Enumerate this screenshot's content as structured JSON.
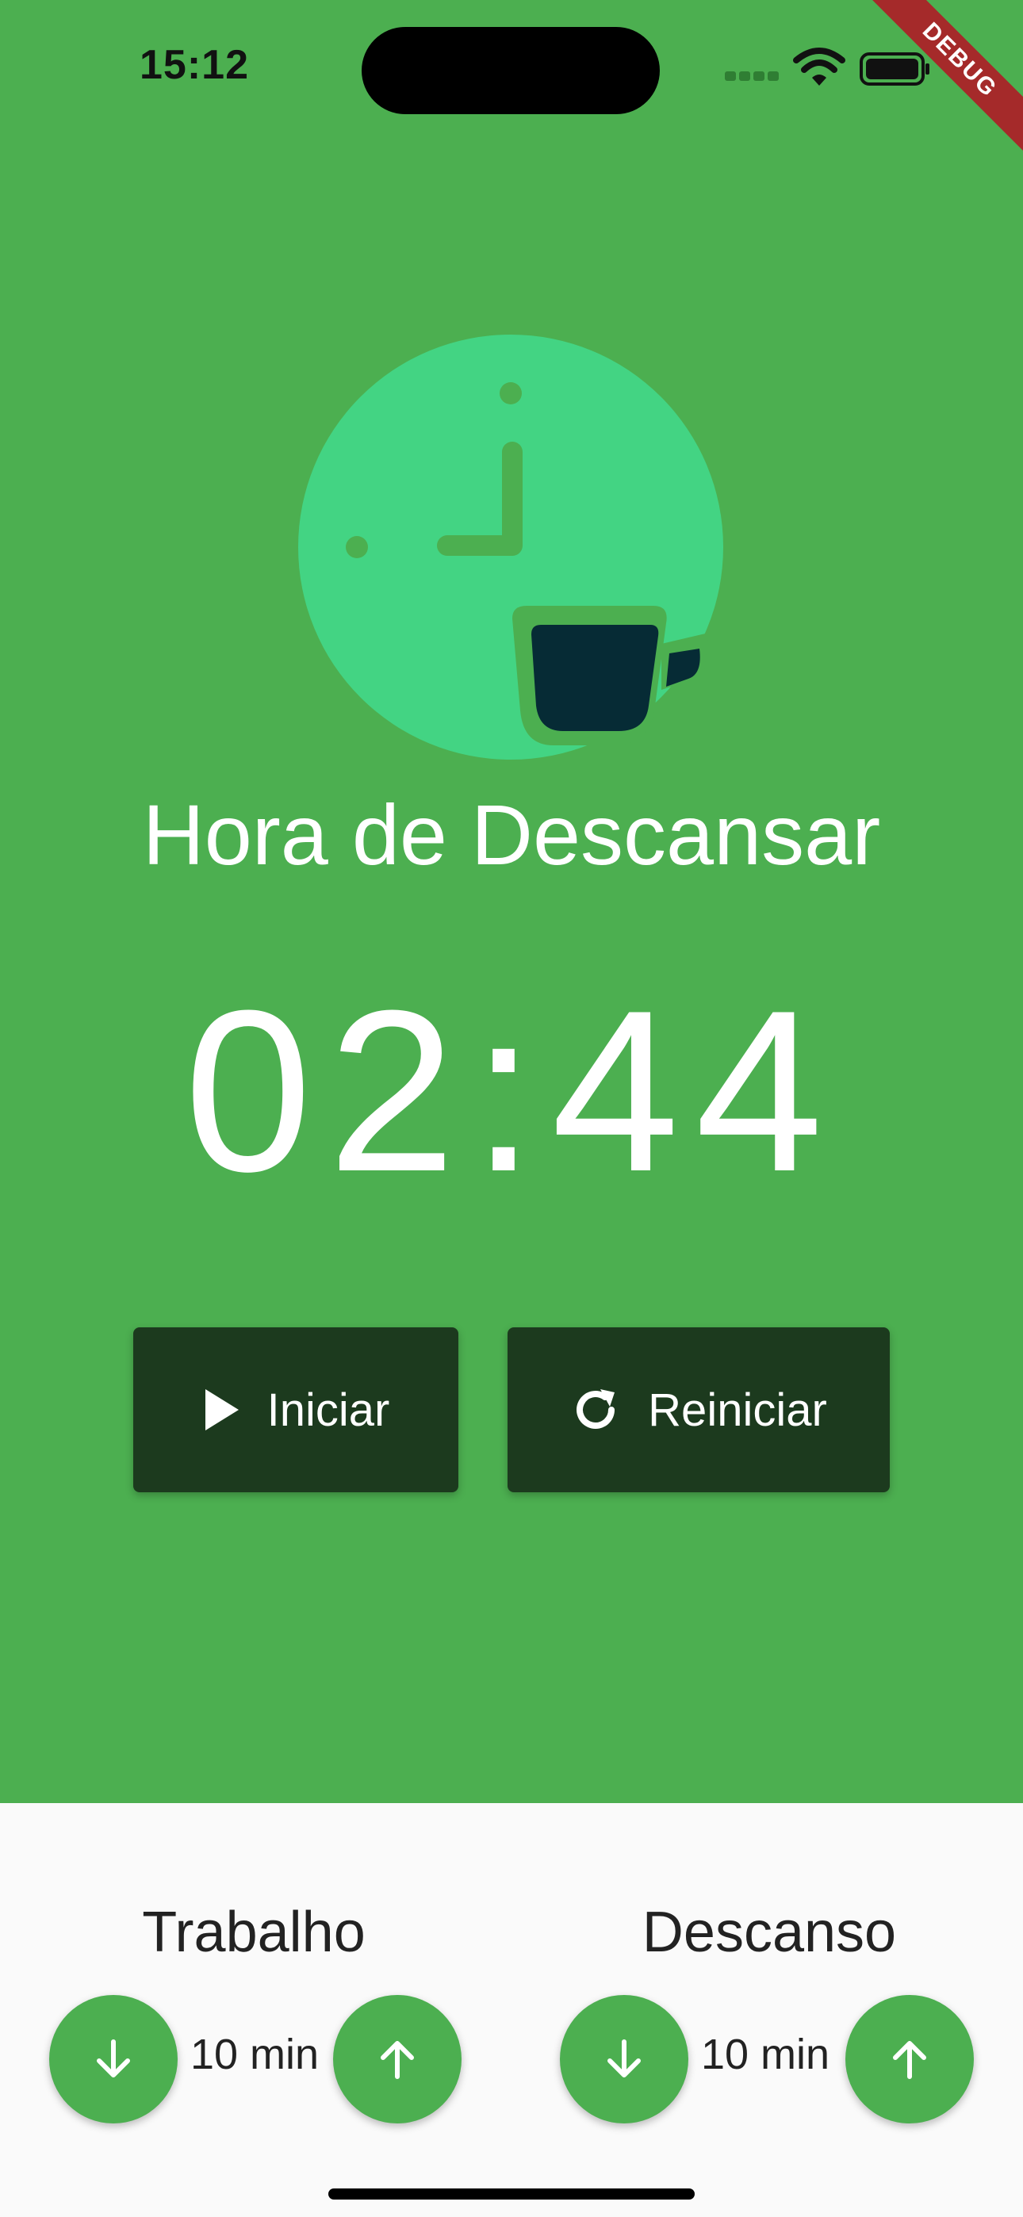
{
  "status_bar": {
    "time": "15:12"
  },
  "debug_banner": "DEBUG",
  "hero": {
    "icon": "clock-coffee-icon",
    "circle_color": "#43D483",
    "cup_color": "#062B35"
  },
  "mode_title": "Hora de Descansar",
  "timer": "02:44",
  "controls": {
    "start_label": "Iniciar",
    "start_icon": "play-icon",
    "reset_label": "Reiniciar",
    "reset_icon": "refresh-icon"
  },
  "settings": {
    "work": {
      "label": "Trabalho",
      "value": "10 min"
    },
    "rest": {
      "label": "Descanso",
      "value": "10 min"
    }
  },
  "colors": {
    "background": "#4CAF50",
    "button_dark": "#1C3A1E",
    "panel": "#FAFAFA",
    "debug": "#A52A2A"
  }
}
